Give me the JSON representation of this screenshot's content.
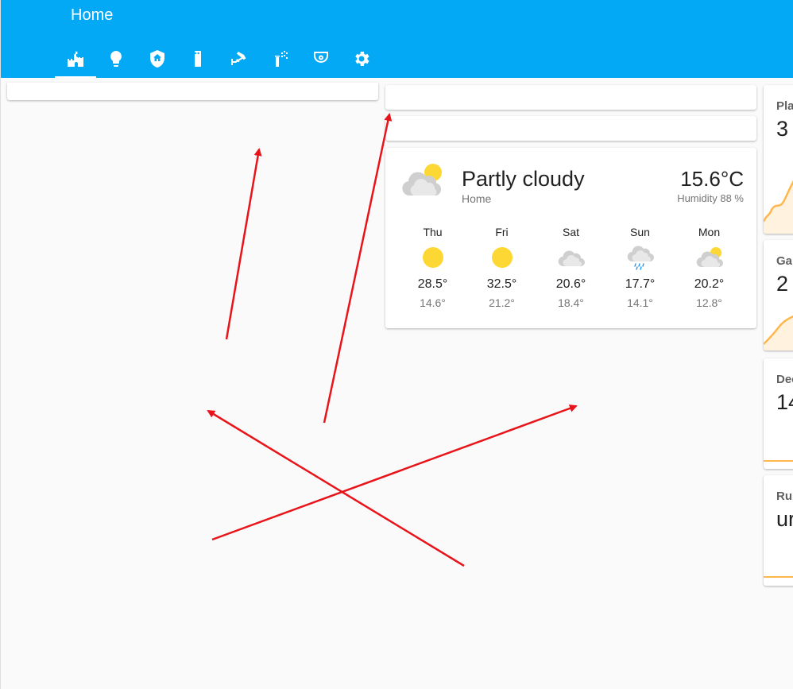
{
  "header": {
    "title": "Home"
  },
  "tabs": [
    {
      "icon": "home-castle-icon",
      "active": true
    },
    {
      "icon": "lightbulb-icon",
      "active": false
    },
    {
      "icon": "shield-home-icon",
      "active": false
    },
    {
      "icon": "remote-icon",
      "active": false
    },
    {
      "icon": "cctv-icon",
      "active": false
    },
    {
      "icon": "sprinkler-icon",
      "active": false
    },
    {
      "icon": "smoke-detector-icon",
      "active": false
    },
    {
      "icon": "settings-icon",
      "active": false
    }
  ],
  "weather": {
    "condition": "Partly cloudy",
    "name": "Home",
    "temperature": "15.6°C",
    "humidity": "Humidity 88 %",
    "forecast": [
      {
        "day": "Thu",
        "icon": "sunny-icon",
        "high": "28.5°",
        "low": "14.6°"
      },
      {
        "day": "Fri",
        "icon": "sunny-icon",
        "high": "32.5°",
        "low": "21.2°"
      },
      {
        "day": "Sat",
        "icon": "cloudy-icon",
        "high": "20.6°",
        "low": "18.4°"
      },
      {
        "day": "Sun",
        "icon": "rainy-icon",
        "high": "17.7°",
        "low": "14.1°"
      },
      {
        "day": "Mon",
        "icon": "partly-cloudy-icon",
        "high": "20.2°",
        "low": "12.8°"
      }
    ]
  },
  "sensors": [
    {
      "name": "Pla",
      "value": "3"
    },
    {
      "name": "Gar",
      "value": "2"
    },
    {
      "name": "Dec",
      "value": "14"
    },
    {
      "name": "Rub",
      "value": "ur"
    }
  ],
  "colors": {
    "header": "#03a9f4",
    "annotation": "#e8141a",
    "sparkline": "#ffb74d",
    "sun": "#fdd835"
  }
}
